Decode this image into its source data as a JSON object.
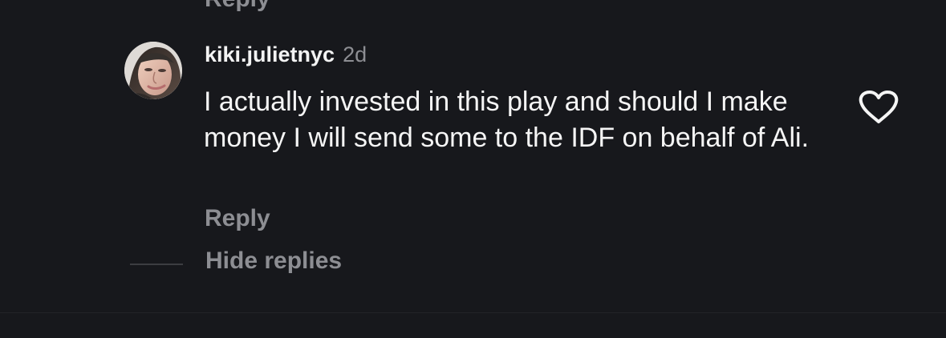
{
  "previous_comment": {
    "reply_label": "Reply"
  },
  "comment": {
    "username": "kiki.julietnyc",
    "time": "2d",
    "text": "I actually invested in this play and should I make money I will send some to the IDF on behalf of Ali.",
    "reply_label": "Reply",
    "avatar_icon": "profile-photo",
    "like_icon": "heart-outline-icon"
  },
  "thread": {
    "hide_replies_label": "Hide replies"
  },
  "colors": {
    "background": "#17181c",
    "primary_text": "#f5f5f5",
    "secondary_text": "#8d8e93",
    "line": "#3c3d41"
  }
}
